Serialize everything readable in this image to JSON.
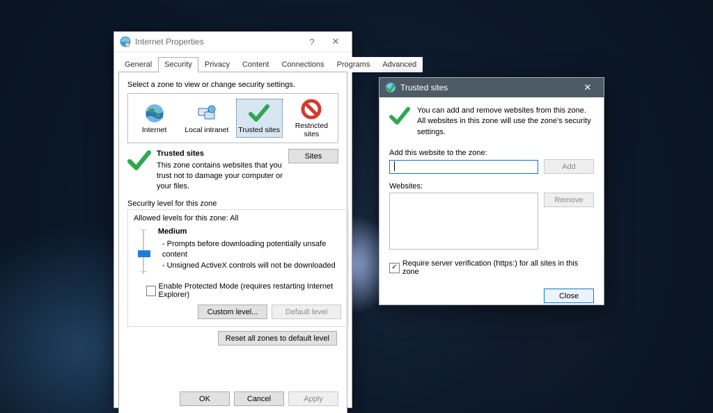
{
  "main_window": {
    "title": "Internet Properties",
    "help_glyph": "?",
    "close_glyph": "✕",
    "tabs": [
      "General",
      "Security",
      "Privacy",
      "Content",
      "Connections",
      "Programs",
      "Advanced"
    ],
    "active_tab_index": 1,
    "zone_select_label": "Select a zone to view or change security settings.",
    "zones": [
      "Internet",
      "Local intranet",
      "Trusted sites",
      "Restricted sites"
    ],
    "selected_zone_index": 2,
    "trusted_header": "Trusted sites",
    "trusted_desc": "This zone contains websites that you trust not to damage your computer or your files.",
    "sites_btn": "Sites",
    "seclevel_label": "Security level for this zone",
    "allowed_levels": "Allowed levels for this zone: All",
    "level_name": "Medium",
    "level_line1": "- Prompts before downloading potentially unsafe content",
    "level_line2": "- Unsigned ActiveX controls will not be downloaded",
    "protected_mode_label": "Enable Protected Mode (requires restarting Internet Explorer)",
    "custom_level_btn": "Custom level...",
    "default_level_btn": "Default level",
    "reset_btn": "Reset all zones to default level",
    "ok_btn": "OK",
    "cancel_btn": "Cancel",
    "apply_btn": "Apply"
  },
  "ts_dialog": {
    "title": "Trusted sites",
    "close_glyph": "✕",
    "intro": "You can add and remove websites from this zone. All websites in this zone will use the zone's security settings.",
    "add_label": "Add this website to the zone:",
    "input_value": "",
    "add_btn": "Add",
    "websites_label": "Websites:",
    "remove_btn": "Remove",
    "require_https": "Require server verification (https:) for all sites in this zone",
    "require_https_checked": true,
    "close_btn": "Close"
  }
}
